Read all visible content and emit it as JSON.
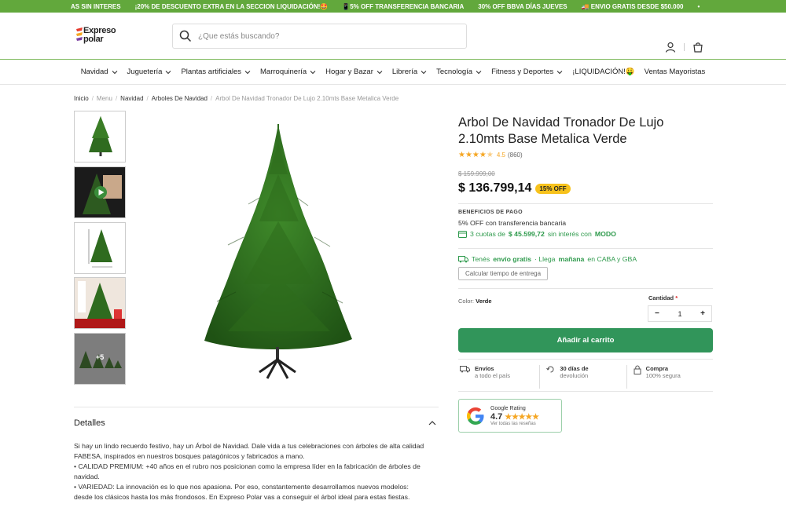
{
  "promo": {
    "items": [
      "AS SIN INTERES",
      "¡20% DE DESCUENTO EXTRA EN LA SECCION LIQUIDACIÓN!🤩",
      "📱5% OFF TRANSFERENCIA BANCARIA",
      "30% OFF BBVA DÍAS JUEVES",
      "🚚 ENVIO GRATIS DESDE $50.000",
      "•"
    ]
  },
  "header": {
    "logo_line1": "Expreso",
    "logo_line2": "polar",
    "search_placeholder": "¿Que estás buscando?"
  },
  "nav": {
    "items": [
      {
        "label": "Navidad",
        "dropdown": true
      },
      {
        "label": "Juguetería",
        "dropdown": true
      },
      {
        "label": "Plantas artificiales",
        "dropdown": true
      },
      {
        "label": "Marroquinería",
        "dropdown": true
      },
      {
        "label": "Hogar y Bazar",
        "dropdown": true
      },
      {
        "label": "Librería",
        "dropdown": true
      },
      {
        "label": "Tecnología",
        "dropdown": true
      },
      {
        "label": "Fitness y Deportes",
        "dropdown": true
      },
      {
        "label": "¡LIQUIDACIÓN!🤑",
        "dropdown": false
      },
      {
        "label": "Ventas Mayoristas",
        "dropdown": false
      }
    ]
  },
  "breadcrumb": [
    "Inicio",
    "Menu",
    "Navidad",
    "Arboles De Navidad",
    "Arbol De Navidad Tronador De Lujo 2.10mts Base Metalica Verde"
  ],
  "gallery": {
    "more_label": "+5"
  },
  "product": {
    "title": "Arbol De Navidad Tronador De Lujo 2.10mts Base Metalica Verde",
    "rating_value": "4.5",
    "rating_count": "(860)",
    "old_price": "$ 159.999,00",
    "price": "$ 136.799,14",
    "discount_badge": "15% OFF",
    "benefits_heading": "BENEFICIOS DE PAGO",
    "benefit_transfer": "5% OFF con transferencia bancaria",
    "benefit_cuotas_pre": "3 cuotas de",
    "benefit_cuotas_amount": "$ 45.599,72",
    "benefit_cuotas_post": "sin interés con",
    "benefit_cuotas_brand": "MODO",
    "shipping_pre": "Tenés",
    "shipping_free": "envío gratis",
    "shipping_mid": "· Llega",
    "shipping_when": "mañana",
    "shipping_post": "en CABA y GBA",
    "calc_button": "Calcular tiempo de entrega",
    "color_label": "Color:",
    "color_value": "Verde",
    "quantity_label": "Cantidad",
    "quantity_required": "*",
    "quantity_value": "1",
    "add_to_cart": "Añadir al carrito"
  },
  "perks": [
    {
      "title": "Envíos",
      "subtitle": "a todo el país",
      "icon": "truck-icon"
    },
    {
      "title": "30 días de",
      "subtitle": "devolución",
      "icon": "return-icon"
    },
    {
      "title": "Compra",
      "subtitle": "100% segura",
      "icon": "lock-icon"
    }
  ],
  "google": {
    "title": "Google Rating",
    "value": "4.7",
    "stars": "★★★★★",
    "link": "Ver todas las reseñas"
  },
  "details": {
    "heading": "Detalles",
    "paragraphs": [
      "Si hay un lindo recuerdo festivo, hay un Árbol de Navidad. Dale vida a tus celebraciones con árboles de alta calidad FABESA, inspirados en nuestros bosques patagónicos y fabricados a mano.",
      "• CALIDAD PREMIUM: +40 años en el rubro nos posicionan como la empresa líder en la fabricación de árboles de navidad.",
      "• VARIEDAD: La innovación es lo que nos apasiona. Por eso, constantemente desarrollamos nuevos modelos: desde los clásicos hasta los más frondosos. En Expreso Polar vas a conseguir el árbol ideal para estas fiestas."
    ]
  },
  "colors": {
    "promo_bg": "#62a83c",
    "accent_green": "#2e9a4c",
    "cart_button": "#31955a",
    "badge": "#f7c21c",
    "stars": "#f5a623"
  }
}
